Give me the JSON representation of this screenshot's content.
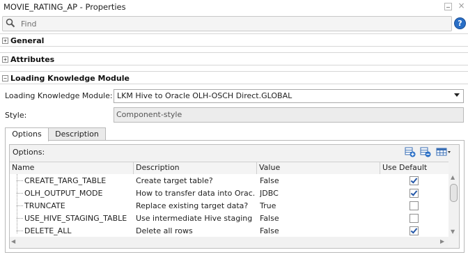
{
  "window": {
    "title": "MOVIE_RATING_AP - Properties"
  },
  "search": {
    "placeholder": "Find"
  },
  "sections": [
    {
      "label": "General",
      "toggle": "+"
    },
    {
      "label": "Attributes",
      "toggle": "+"
    },
    {
      "label": "Loading Knowledge Module",
      "toggle": "−"
    }
  ],
  "form": {
    "lkm_label": "Loading Knowledge Module:",
    "lkm_value": "LKM Hive to Oracle OLH-OSCH Direct.GLOBAL",
    "style_label": "Style:",
    "style_value": "Component-style"
  },
  "tabs": [
    {
      "label": "Options",
      "selected": true
    },
    {
      "label": "Description",
      "selected": false
    }
  ],
  "options": {
    "title": "Options:",
    "columns": [
      "Name",
      "Description",
      "Value",
      "Use Default"
    ],
    "rows": [
      {
        "name": "CREATE_TARG_TABLE",
        "description": "Create target table?",
        "value": "False",
        "use_default": true
      },
      {
        "name": "OLH_OUTPUT_MODE",
        "description": "How to transfer data into Orac...",
        "value": "JDBC",
        "use_default": true
      },
      {
        "name": "TRUNCATE",
        "description": "Replace existing target data?",
        "value": "True",
        "use_default": false
      },
      {
        "name": "USE_HIVE_STAGING_TABLE",
        "description": "Use intermediate Hive staging ...",
        "value": "False",
        "use_default": false
      },
      {
        "name": "DELETE_ALL",
        "description": "Delete all rows",
        "value": "False",
        "use_default": true
      }
    ]
  },
  "colors": {
    "accent": "#2a6fc6",
    "check": "#2558a8"
  },
  "icons": [
    "search-icon",
    "help-icon",
    "add-row-icon",
    "remove-row-icon",
    "table-columns-icon"
  ]
}
